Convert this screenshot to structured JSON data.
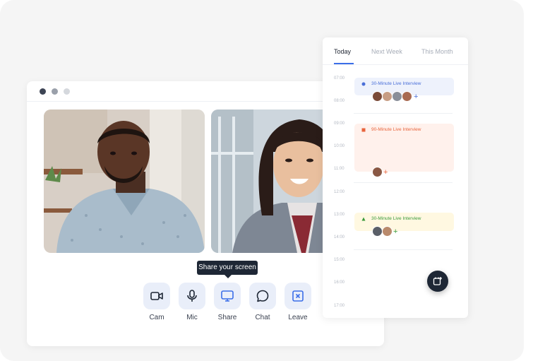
{
  "controls": {
    "tooltip": "Share your screen",
    "cam": "Cam",
    "mic": "Mic",
    "share": "Share",
    "chat": "Chat",
    "leave": "Leave"
  },
  "calendar": {
    "tabs": [
      "Today",
      "Next Week",
      "This Month"
    ],
    "times": [
      "07:00",
      "08:00",
      "09:00",
      "10:00",
      "11:00",
      "12:00",
      "13:00",
      "14:00",
      "15:00",
      "16:00",
      "17:00"
    ],
    "events": [
      {
        "title": "30-Minute Live Interview",
        "color": "#4a6fd8",
        "bg": "#eef2fc"
      },
      {
        "title": "90-Minute Live Interview",
        "color": "#e8643c",
        "bg": "#fff1ec"
      },
      {
        "title": "30-Minute Live Interview",
        "color": "#3a9a3a",
        "bg": "#fff8e1"
      }
    ],
    "add_glyph": "+"
  },
  "colors": {
    "accent": "#3b6ee8",
    "dark": "#1e2735",
    "leave": "#3b6ee8"
  }
}
